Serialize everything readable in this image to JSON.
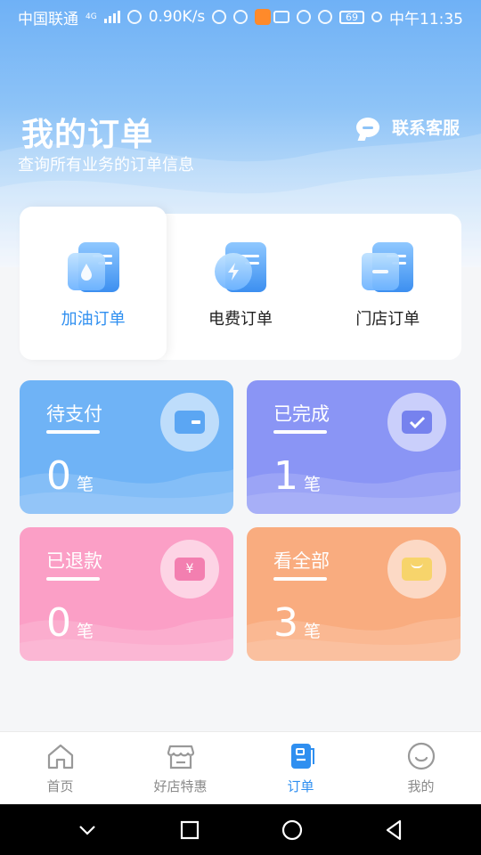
{
  "status": {
    "carrier": "中国联通",
    "net_type": "4G",
    "speed": "0.90K/s",
    "battery": "69",
    "time": "中午11:35"
  },
  "header": {
    "title": "我的订单",
    "subtitle": "查询所有业务的订单信息",
    "service_label": "联系客服"
  },
  "categories": [
    {
      "label": "加油订单",
      "icon": "fuel-order-icon",
      "active": true
    },
    {
      "label": "电费订单",
      "icon": "electricity-order-icon",
      "active": false
    },
    {
      "label": "门店订单",
      "icon": "store-order-icon",
      "active": false
    }
  ],
  "stats": [
    {
      "title": "待支付",
      "count": "0",
      "unit": "笔",
      "color": "#6fb3f6",
      "icon": "wallet-icon"
    },
    {
      "title": "已完成",
      "count": "1",
      "unit": "笔",
      "color": "#8a95f5",
      "icon": "check-card-icon"
    },
    {
      "title": "已退款",
      "count": "0",
      "unit": "笔",
      "color": "#fb9fc6",
      "icon": "yen-bag-icon"
    },
    {
      "title": "看全部",
      "count": "3",
      "unit": "笔",
      "color": "#f9ac7f",
      "icon": "box-icon"
    }
  ],
  "tabs": [
    {
      "label": "首页",
      "icon": "home-icon"
    },
    {
      "label": "好店特惠",
      "icon": "shop-icon"
    },
    {
      "label": "订单",
      "icon": "order-icon",
      "active": true
    },
    {
      "label": "我的",
      "icon": "smile-icon"
    }
  ],
  "colors": {
    "accent": "#2f8ff0",
    "hero_top": "#6fb1f6"
  }
}
